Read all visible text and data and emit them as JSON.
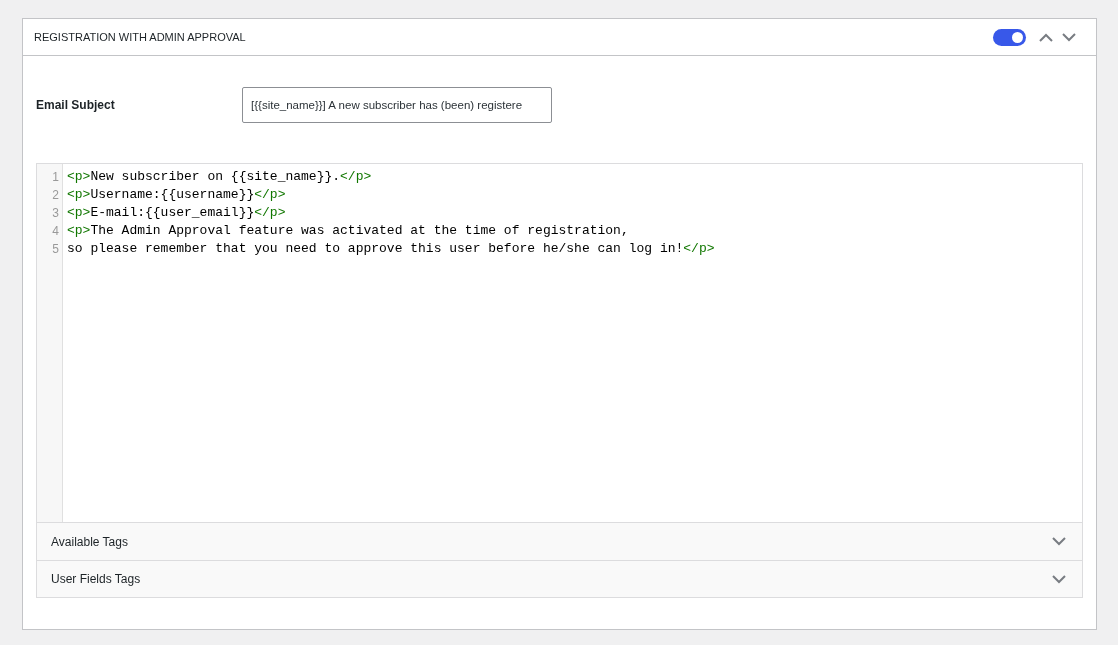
{
  "panel": {
    "title": "REGISTRATION WITH ADMIN APPROVAL",
    "enabled": true
  },
  "subject": {
    "label": "Email Subject",
    "value": "[{{site_name}}] A new subscriber has (been) registere"
  },
  "editor": {
    "lines": [
      {
        "number": "1",
        "tokens": [
          {
            "kind": "tag",
            "text": "<p>"
          },
          {
            "kind": "text",
            "text": "New subscriber on {{site_name}}."
          },
          {
            "kind": "tag",
            "text": "</p>"
          }
        ]
      },
      {
        "number": "2",
        "tokens": [
          {
            "kind": "tag",
            "text": "<p>"
          },
          {
            "kind": "text",
            "text": "Username:{{username}}"
          },
          {
            "kind": "tag",
            "text": "</p>"
          }
        ]
      },
      {
        "number": "3",
        "tokens": [
          {
            "kind": "tag",
            "text": "<p>"
          },
          {
            "kind": "text",
            "text": "E-mail:{{user_email}}"
          },
          {
            "kind": "tag",
            "text": "</p>"
          }
        ]
      },
      {
        "number": "4",
        "tokens": [
          {
            "kind": "tag",
            "text": "<p>"
          },
          {
            "kind": "text",
            "text": "The Admin Approval feature was activated at the time of registration,"
          }
        ]
      },
      {
        "number": "5",
        "tokens": [
          {
            "kind": "text",
            "text": "so please remember that you need to approve this user before he/she can log in!"
          },
          {
            "kind": "tag",
            "text": "</p>"
          }
        ]
      }
    ]
  },
  "accordions": [
    {
      "label": "Available Tags",
      "expanded": false
    },
    {
      "label": "User Fields Tags",
      "expanded": false
    }
  ]
}
